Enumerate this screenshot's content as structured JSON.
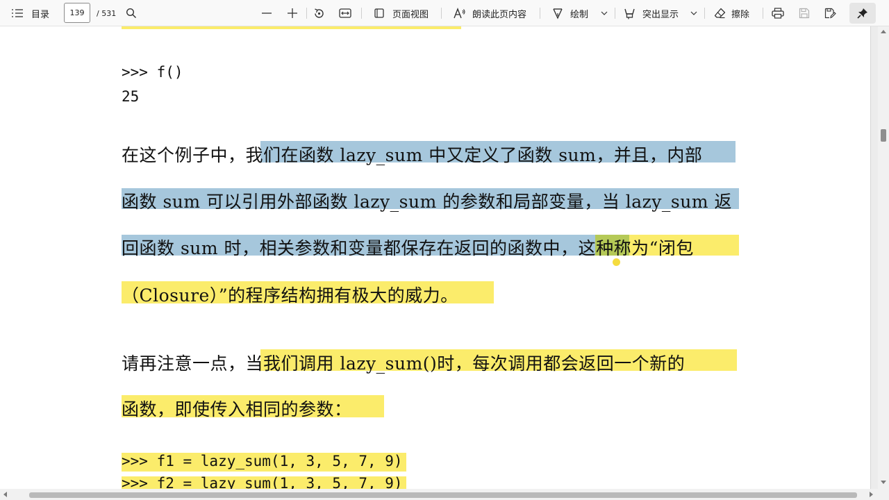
{
  "toolbar": {
    "toc_label": "目录",
    "page_current": "139",
    "page_total": "/ 531",
    "page_view_label": "页面视图",
    "read_aloud_label": "朗读此页内容",
    "draw_label": "绘制",
    "highlight_label": "突出显示",
    "erase_label": "擦除"
  },
  "content": {
    "code_top": [
      ">>> f()",
      "25"
    ],
    "para1": {
      "line1_plain": "在这个例子中，",
      "line1_hl": "我们在函数 lazy_sum 中又定义了函数 sum，并且，内部",
      "line2": "函数 sum 可以引用外部函数 lazy_sum 的参数和局部变量，当 lazy_sum 返",
      "line3_blue": "回函数 sum 时，相关参数和变量都保存在返回的函数中",
      "line3_green": "，这",
      "line3_yellow": "种称为“闭包",
      "line4": "（Closure）”的程序结构拥有极大的威力。"
    },
    "para2": {
      "line1_plain": "请再注意一点，",
      "line1_hl": "当我们调用 lazy_sum()时，每次调用都会返回一个新的",
      "line2": "函数，即使传入相同的参数："
    },
    "code_bottom": [
      ">>> f1 = lazy_sum(1, 3, 5, 7, 9)",
      ">>> f2 = lazy_sum(1, 3, 5, 7, 9)"
    ]
  },
  "colors": {
    "highlight_yellow": "#fbec6b",
    "highlight_blue": "#a6c7dc",
    "highlight_green": "#b5c957"
  }
}
